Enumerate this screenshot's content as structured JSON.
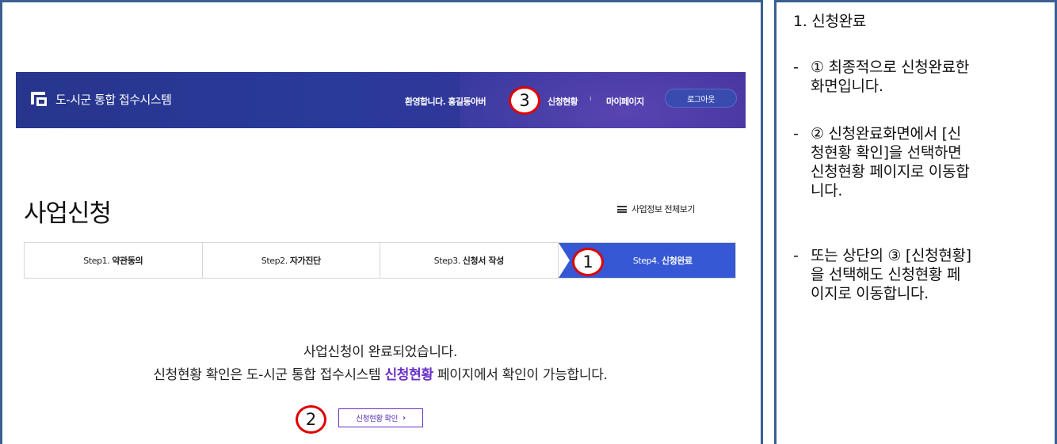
{
  "header": {
    "site_title": "도-시군 통합 접수시스템",
    "welcome_text": "환영합니다. 홍길동아버",
    "nav_apply_status": "신청현황",
    "nav_separator": "ı",
    "nav_mypage": "마이페이지",
    "logout_label": "로그아웃"
  },
  "page": {
    "title": "사업신청",
    "view_all_label": "사업정보 전체보기"
  },
  "steps": [
    {
      "prefix": "Step1.",
      "label": "약관동의"
    },
    {
      "prefix": "Step2.",
      "label": "자가진단"
    },
    {
      "prefix": "Step3.",
      "label": "신청서 작성"
    },
    {
      "prefix": "Step4.",
      "label": "신청완료"
    }
  ],
  "completion": {
    "line1": "사업신청이 완료되었습니다.",
    "line2_before": "신청현황 확인은 도-시군 통합 접수시스템 ",
    "line2_highlight": "신청현황",
    "line2_after": " 페이지에서 확인이 가능합니다.",
    "confirm_button": "신청현황 확인"
  },
  "markers": {
    "one": "1",
    "two": "2",
    "three": "3"
  },
  "notes": {
    "title": "1.  신청완료",
    "items": [
      "① 최종적으로 신청완료한\n화면입니다.",
      "② 신청완료화면에서 [신\n청현황 확인]을 선택하면\n신청현황 페이지로 이동합\n니다.",
      "또는 상단의 ③ [신청현황]\n을 선택해도 신청현황 페\n이지로 이동합니다."
    ],
    "dash": "-"
  },
  "colors": {
    "frame": "#3a5f93",
    "header_bg": "#27358d",
    "active_step": "#3658d4",
    "highlight": "#6a2fc8",
    "marker": "#e00000"
  }
}
